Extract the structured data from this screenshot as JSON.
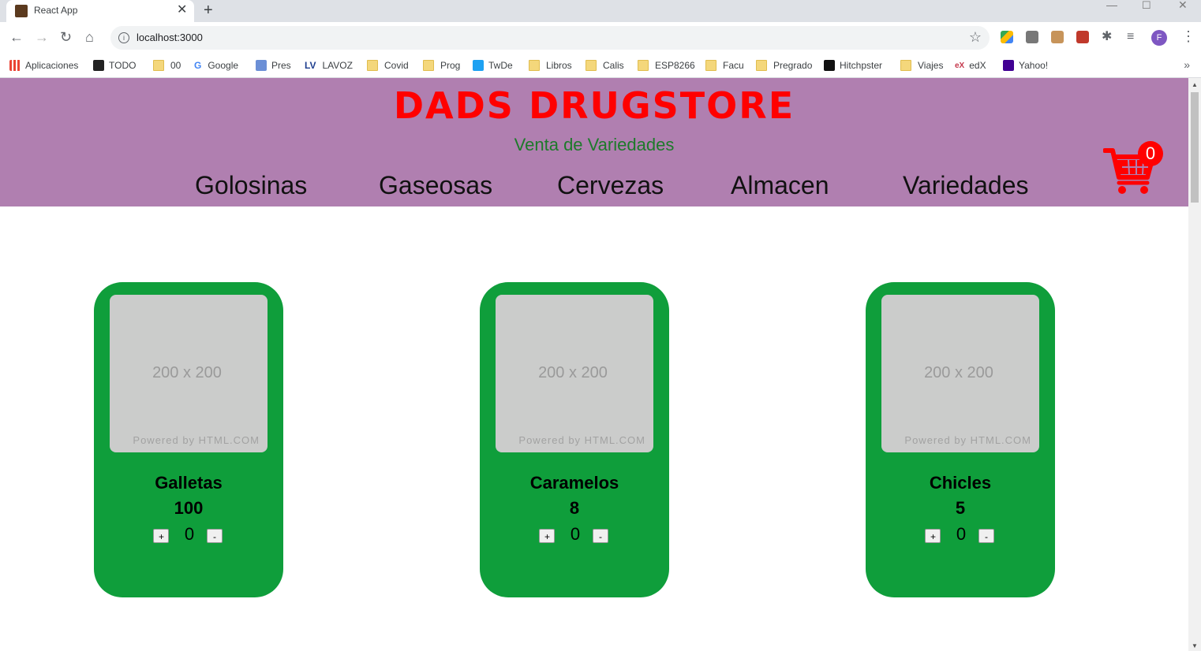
{
  "browser": {
    "tab_title": "React App",
    "tab_close": "✕",
    "new_tab": "+",
    "url": "localhost:3000",
    "avatar_letter": "F",
    "bookmarks": [
      "Aplicaciones",
      "TODO",
      "00",
      "Google",
      "Pres",
      "LAVOZ",
      "Covid",
      "Prog",
      "TwDe",
      "Libros",
      "Calis",
      "ESP8266",
      "Facu",
      "Pregrado",
      "Hitchpster",
      "Viajes",
      "edX",
      "Yahoo!"
    ],
    "bookmarks_more": "»"
  },
  "site": {
    "brand": "DADS DRUGSTORE",
    "tagline": "Venta de Variedades",
    "nav": [
      "Golosinas",
      "Gaseosas",
      "Cervezas",
      "Almacen",
      "Variedades"
    ],
    "cart_count": "0",
    "cart_color": "#ff0000"
  },
  "products": [
    {
      "name": "Galletas",
      "price": "100",
      "qty": "0",
      "plus": "+",
      "minus": "-",
      "img_size": "200 x 200",
      "img_powered": "Powered by HTML.COM"
    },
    {
      "name": "Caramelos",
      "price": "8",
      "qty": "0",
      "plus": "+",
      "minus": "-",
      "img_size": "200 x 200",
      "img_powered": "Powered by HTML.COM"
    },
    {
      "name": "Chicles",
      "price": "5",
      "qty": "0",
      "plus": "+",
      "minus": "-",
      "img_size": "200 x 200",
      "img_powered": "Powered by HTML.COM"
    }
  ],
  "colors": {
    "header_bg": "#b07fb0",
    "card_bg": "#0f9e3b",
    "brand": "#ff0000",
    "tagline": "#1d7a2a"
  }
}
